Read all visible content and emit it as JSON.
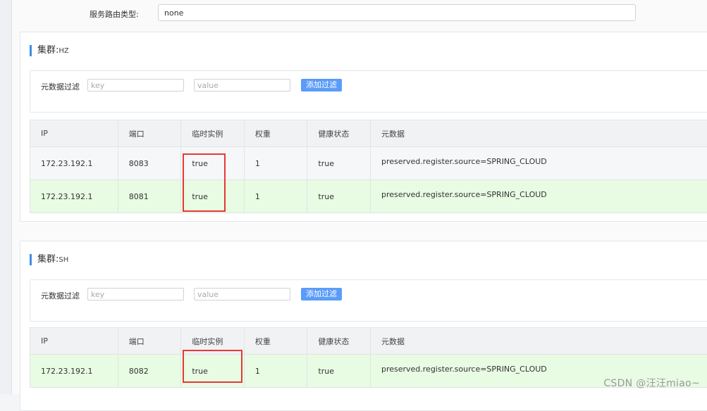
{
  "route": {
    "label": "服务路由类型:",
    "value": "none"
  },
  "clusters": [
    {
      "title_prefix": "集群:",
      "name": "HZ",
      "filter": {
        "label": "元数据过滤",
        "key_placeholder": "key",
        "value_placeholder": "value",
        "add_label": "添加过滤"
      },
      "columns": [
        "IP",
        "端口",
        "临时实例",
        "权重",
        "健康状态",
        "元数据"
      ],
      "rows": [
        {
          "ip": "172.23.192.1",
          "port": "8083",
          "ephemeral": "true",
          "weight": "1",
          "health": "true",
          "metadata": "preserved.register.source=SPRING_CLOUD"
        },
        {
          "ip": "172.23.192.1",
          "port": "8081",
          "ephemeral": "true",
          "weight": "1",
          "health": "true",
          "metadata": "preserved.register.source=SPRING_CLOUD"
        }
      ]
    },
    {
      "title_prefix": "集群:",
      "name": "SH",
      "filter": {
        "label": "元数据过滤",
        "key_placeholder": "key",
        "value_placeholder": "value",
        "add_label": "添加过滤"
      },
      "columns": [
        "IP",
        "端口",
        "临时实例",
        "权重",
        "健康状态",
        "元数据"
      ],
      "rows": [
        {
          "ip": "172.23.192.1",
          "port": "8082",
          "ephemeral": "true",
          "weight": "1",
          "health": "true",
          "metadata": "preserved.register.source=SPRING_CLOUD"
        }
      ]
    }
  ],
  "colors": {
    "accent": "#3a8ee6",
    "button": "#5a9cf8",
    "row_green": "#e8fbe3",
    "highlight_box": "#e53935"
  },
  "watermark": "CSDN @汪汪miao~"
}
